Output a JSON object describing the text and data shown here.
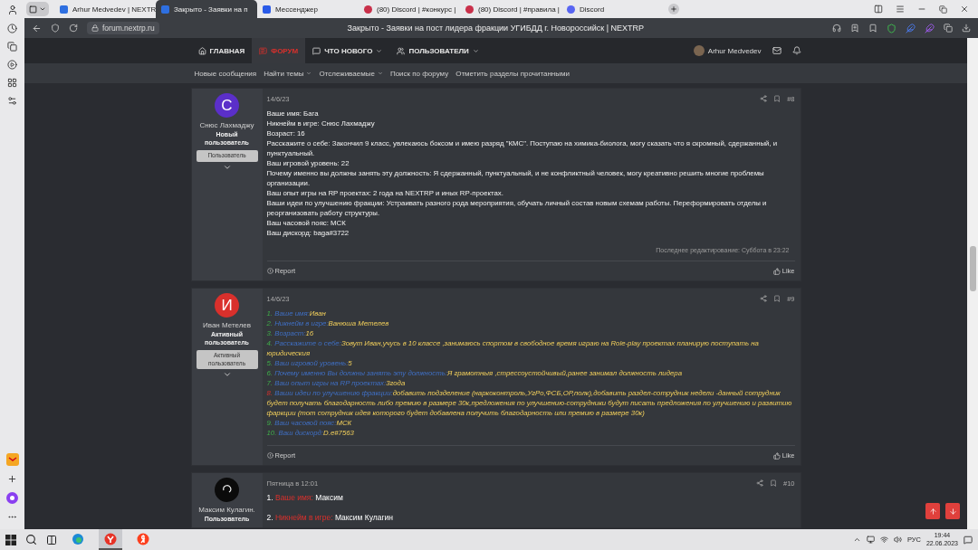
{
  "browser_tabs": [
    {
      "kind": "forum",
      "label": "Arhur Medvedev | NEXTR",
      "selected": false
    },
    {
      "kind": "forum",
      "label": "Закрыто - Заявки на п",
      "selected": true
    },
    {
      "kind": "messenger",
      "label": "Мессенджер",
      "selected": false
    },
    {
      "kind": "discord-server",
      "label": "(80) Discord | #конкурс |",
      "selected": false
    },
    {
      "kind": "discord-server",
      "label": "(80) Discord | #правила |",
      "selected": false
    },
    {
      "kind": "discord",
      "label": "Discord",
      "selected": false
    }
  ],
  "address_bar": {
    "url": "forum.nextrp.ru",
    "page_title": "Закрыто - Заявки на пост лидера фракции УГИБДД г. Новороссийск | NEXTRP"
  },
  "forum_nav": {
    "items": [
      {
        "kind": "home",
        "label": "ГЛАВНАЯ",
        "selected": false,
        "has_menu": false
      },
      {
        "kind": "forum",
        "label": "ФОРУМ",
        "selected": true,
        "has_menu": false
      },
      {
        "kind": "news",
        "label": "ЧТО НОВОГО",
        "selected": false,
        "has_menu": true
      },
      {
        "kind": "users",
        "label": "ПОЛЬЗОВАТЕЛИ",
        "selected": false,
        "has_menu": true
      }
    ],
    "user": "Arhur Medvedev"
  },
  "sub_nav": [
    {
      "label": "Новые сообщения",
      "has_menu": false
    },
    {
      "label": "Найти темы",
      "has_menu": true
    },
    {
      "label": "Отслеживаемые",
      "has_menu": true
    },
    {
      "label": "Поиск по форуму",
      "has_menu": false
    },
    {
      "label": "Отметить разделы прочитанными",
      "has_menu": false
    }
  ],
  "posts": [
    {
      "author": {
        "name": "Снюс Лахмаджу",
        "title": "Новый пользователь",
        "badge": "Пользователь",
        "avatar": {
          "kind": "letter",
          "initial": "С",
          "color": "#5b2fc9"
        }
      },
      "date": "14/6/23",
      "number": "#8",
      "kind": "compact",
      "lines": [
        {
          "kind": "text",
          "text": "Ваше имя: Бага"
        },
        {
          "kind": "text",
          "text": "Никнейм в игре: Снюс Лахмаджу"
        },
        {
          "kind": "text",
          "text": "Возраст: 16"
        },
        {
          "kind": "text",
          "text": "Расскажите о себе: Закончил 9 класс, увлекаюсь боксом и имею разряд \"КМС\". Поступаю на химика-биолога, могу сказать что я скромный, сдержанный, и пунктуальный."
        },
        {
          "kind": "text",
          "text": "Ваш игровой уровень: 22"
        },
        {
          "kind": "text",
          "text": "Почему именно вы должны занять эту должность: Я сдержанный, пунктуальный, и не конфликтный человек, могу креативно решить многие проблемы организации."
        },
        {
          "kind": "text",
          "text": "Ваш опыт игры на RP проектах: 2 года на NEXTRP и иных RP-проектах."
        },
        {
          "kind": "text",
          "text": "Ваши идеи по улучшению фракции: Устраивать разного рода мероприятия, обучать личный состав новым схемам работы. Переформировать отделы и реорганизовать работу структуры."
        },
        {
          "kind": "text",
          "text": "Ваш часовой пояс: МСК"
        },
        {
          "kind": "text",
          "text": "Ваш дискорд: baga#3722"
        }
      ],
      "edited": "Последнее редактирование: Суббота в 23:22",
      "report": "Report",
      "like": "Like"
    },
    {
      "author": {
        "name": "Иван Метелев",
        "title": "Активный пользователь",
        "badge": "Активный пользователь",
        "avatar": {
          "kind": "letter",
          "initial": "И",
          "color": "#d9302c"
        }
      },
      "date": "14/6/23",
      "number": "#9",
      "kind": "compact",
      "lines": [
        {
          "kind": "question",
          "number": "1.",
          "label": "Ваше имя:",
          "value": "Иван"
        },
        {
          "kind": "question",
          "number": "2.",
          "label": "Никнейм в игре:",
          "value": "Ванюша Метелев"
        },
        {
          "kind": "question",
          "number": "3.",
          "label": "Возраст:",
          "value": "16"
        },
        {
          "kind": "question",
          "number": "4.",
          "label": "Расскажите о себе:",
          "value": "Зовут Иван,учусь в 10 классе ,занимаюсь спортом в свободное время играю на Role-play проектах планирую поступать на юридическия"
        },
        {
          "kind": "question",
          "number": "5.",
          "label": "Ваш игровой уровень:",
          "value": "5"
        },
        {
          "kind": "question",
          "number": "6.",
          "label": "Почему именно Вы должны занять эту должность:",
          "value": "Я грамотныя ,стрессоустойчивый,ранее занимал должность лидера"
        },
        {
          "kind": "question",
          "number": "7.",
          "label": "Ваш опыт игры на RP проектах:",
          "value": "3года"
        },
        {
          "kind": "question-alert",
          "number": "8.",
          "label": "Ваши идеи по улучшению фракции:",
          "value": "добавить подзделение (наркоконтроль,УгРо,ФСБ,ОР,полк),добавить раздел-сотрудник недели -данный сотрудник будет получать благодарность либо премию в размере 30к,предложения по улучшению-сотрудники будут писать предложения по улучшению и развитию фаркции (тот сотрудник идея которого будет добавлена получить благодарность или премию в размере 30к)"
        },
        {
          "kind": "question",
          "number": "9.",
          "label": "Ваш часовой пояс:",
          "value": "МСК"
        },
        {
          "kind": "question",
          "number": "10.",
          "label": "Ваш дискорд:",
          "value": "D.e#7563"
        }
      ],
      "report": "Report",
      "like": "Like"
    },
    {
      "author": {
        "name": "Максим Кулагин.",
        "title": "Пользователь",
        "avatar": {
          "kind": "image"
        }
      },
      "date": "Пятница в 12:01",
      "number": "#10",
      "kind": "spaced",
      "lines": [
        {
          "kind": "labelled",
          "number": "1.",
          "label": "Ваше имя:",
          "value": "Максим"
        },
        {
          "kind": "labelled",
          "number": "2.",
          "label": "Никнейм в игре:",
          "value": "Максим Кулагин"
        }
      ]
    }
  ],
  "taskbar": {
    "apps": [
      {
        "kind": "edge",
        "selected": false
      },
      {
        "kind": "yandex-browser",
        "selected": true
      },
      {
        "kind": "yandex",
        "selected": false
      }
    ],
    "language": "РУС",
    "time": "19:44",
    "date": "22.06.2023"
  }
}
